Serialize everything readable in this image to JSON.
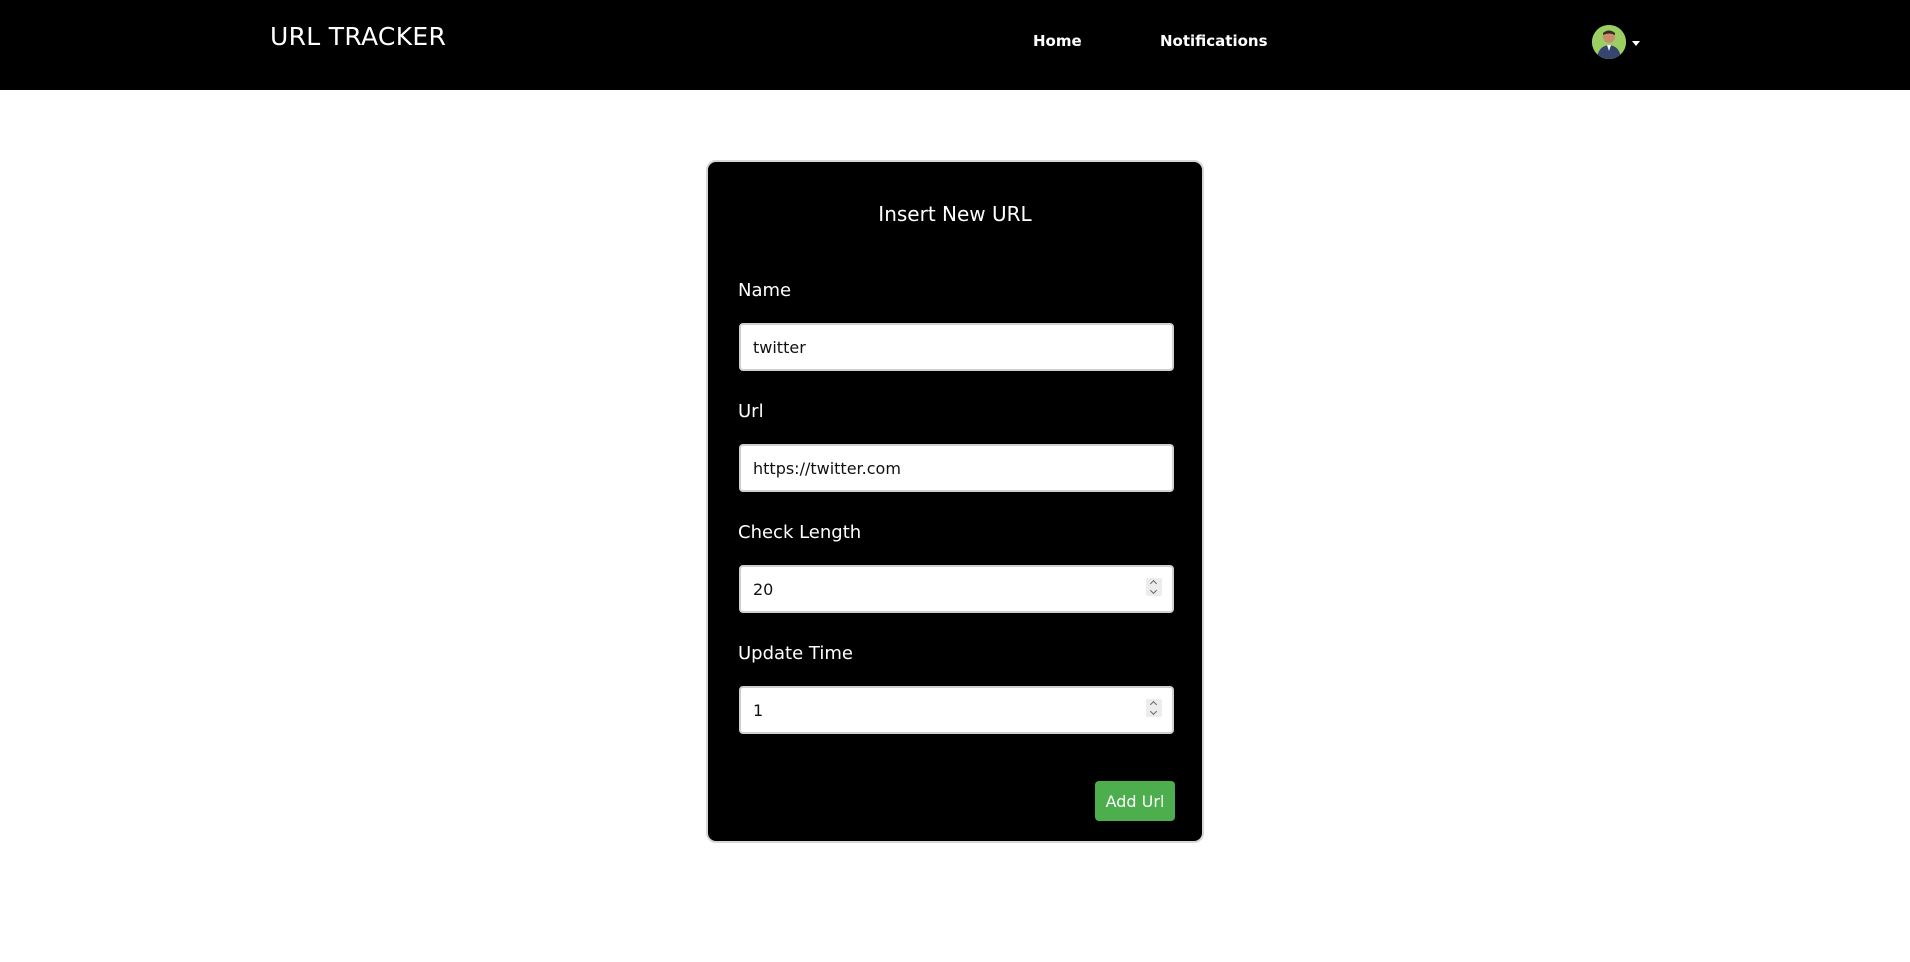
{
  "navbar": {
    "brand": "URL TRACKER",
    "links": [
      {
        "label": "Home"
      },
      {
        "label": "Notifications"
      }
    ],
    "user_menu": {
      "avatar_icon": "user-avatar",
      "caret_icon": "caret-down-icon"
    }
  },
  "form": {
    "title": "Insert New URL",
    "fields": {
      "name": {
        "label": "Name",
        "value": "twitter"
      },
      "url": {
        "label": "Url",
        "value": "https://twitter.com"
      },
      "check_length": {
        "label": "Check Length",
        "value": "20"
      },
      "update_time": {
        "label": "Update Time",
        "value": "1"
      }
    },
    "submit_label": "Add Url"
  },
  "colors": {
    "navbar_bg": "#000000",
    "card_bg": "#000000",
    "button_bg": "#4cae4c",
    "text_light": "#ffffff"
  }
}
